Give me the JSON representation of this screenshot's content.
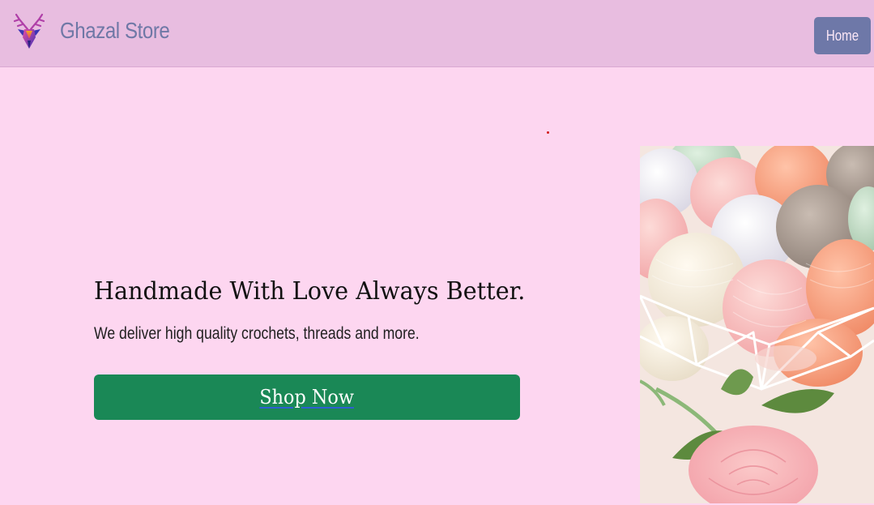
{
  "navbar": {
    "brand": "Ghazal Store",
    "home_label": "Home",
    "logo_icon": "deer-head-icon"
  },
  "hero": {
    "headline": "Handmade With Love Always Better.",
    "subline": "We deliver high quality crochets, threads and more.",
    "cta_label": "Shop Now",
    "image": "yarn-balls-with-roses-image"
  },
  "colors": {
    "page_bg": "#fdd6f0",
    "navbar_bg": "#e8bde0",
    "brand_text": "#6f78a6",
    "home_button": "#6e78a8",
    "cta_button": "#1a8856"
  }
}
